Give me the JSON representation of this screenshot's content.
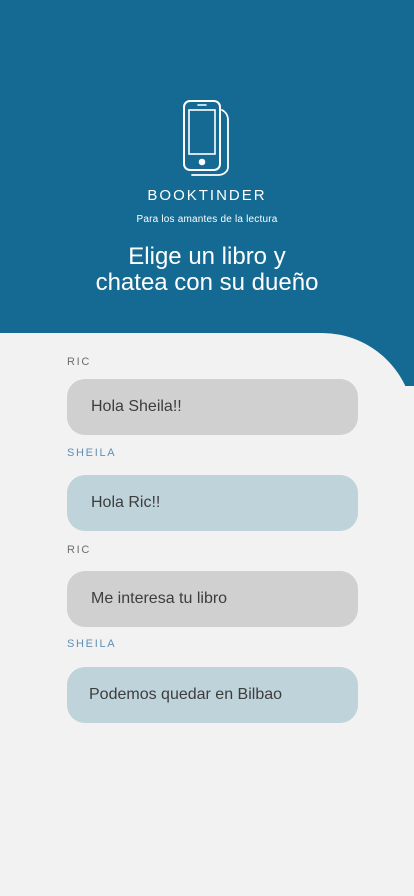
{
  "app": {
    "brand": "BOOKTINDER",
    "tagline": "Para los  amantes de la lectura",
    "headline_line1": "Elige un libro y",
    "headline_line2": "chatea con su dueño",
    "icon": "phone-book-icon",
    "colors": {
      "hero_blue": "#146a92",
      "background": "#f2f2f2",
      "ric_bubble": "#d0d0d0",
      "sheila_bubble": "#bfd3db",
      "sheila_label": "#5f8fb5"
    }
  },
  "chat": {
    "messages": [
      {
        "sender": "RIC",
        "text": "Hola Sheila!!"
      },
      {
        "sender": "SHEILA",
        "text": "Hola Ric!!"
      },
      {
        "sender": "RIC",
        "text": "Me interesa tu libro"
      },
      {
        "sender": "SHEILA",
        "text": "Podemos quedar en Bilbao"
      }
    ]
  }
}
